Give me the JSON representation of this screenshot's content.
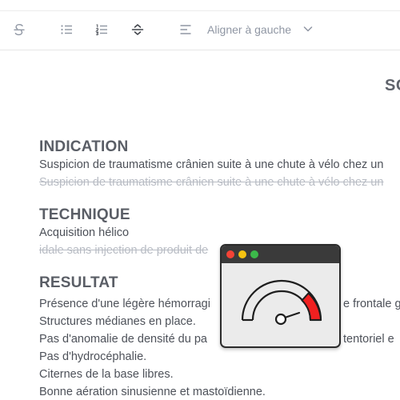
{
  "toolbar": {
    "buttons": [
      {
        "name": "strikethrough-icon"
      },
      {
        "name": "bullet-list-icon"
      },
      {
        "name": "numbered-list-icon"
      },
      {
        "name": "horizontal-rule-icon"
      },
      {
        "name": "align-left-icon"
      }
    ],
    "align_label": "Aligner à gauche",
    "align_dropdown_icon": "chevron-down-icon"
  },
  "document": {
    "title": "SC",
    "sections": [
      {
        "heading": "INDICATION",
        "lines": [
          {
            "text": "Suspicion de traumatisme crânien suite à une chute à vélo chez un",
            "strike": false
          },
          {
            "text": "Suspicion de traumatisme crânien suite à une chute à vélo chez un",
            "strike": true
          }
        ]
      },
      {
        "heading": "TECHNIQUE",
        "lines": [
          {
            "text": "Acquisition hélico",
            "strike": false
          },
          {
            "text": "idale sans injection de produit de",
            "strike": true
          }
        ]
      },
      {
        "heading": "RESULTAT",
        "lines": [
          {
            "text": "Présence d'une légère hémorragi",
            "strike": false,
            "tail": "e frontale g"
          },
          {
            "text": "Structures médianes en place.",
            "strike": false
          },
          {
            "text": "Pas d'anomalie de densité du pa",
            "strike": false,
            "tail": "tentoriel e"
          },
          {
            "text": "Pas d'hydrocéphalie.",
            "strike": false
          },
          {
            "text": "Citernes de la base libres.",
            "strike": false
          },
          {
            "text": "Bonne aération sinusienne et mastoïdienne.",
            "strike": false
          }
        ]
      }
    ]
  },
  "app_icon": {
    "name": "gauge-app-window-icon",
    "colors": {
      "titlebar": "#3a3a3a",
      "close": "#f44336",
      "minimize": "#f5c211",
      "maximize": "#3cb94a",
      "gauge_red_zone": "#f02020"
    }
  },
  "colors": {
    "heading": "#5a5e66",
    "body_text": "#4d5159",
    "strike_text": "#b8bcc4",
    "toolbar_icon": "#8f96a3"
  }
}
